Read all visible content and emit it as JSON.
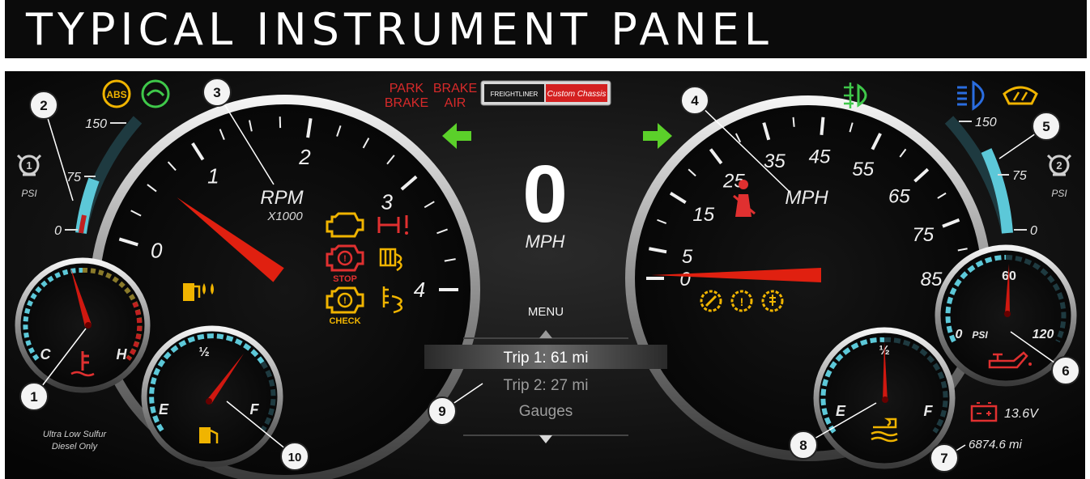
{
  "title": "TYPICAL INSTRUMENT PANEL",
  "tachometer": {
    "label": "RPM",
    "unit": "X1000",
    "ticks": [
      "0",
      "1",
      "2",
      "3",
      "4"
    ],
    "needle_value": 0.5
  },
  "speedometer": {
    "label": "MPH",
    "ticks": [
      "0",
      "5",
      "15",
      "25",
      "35",
      "45",
      "55",
      "65",
      "75",
      "85"
    ],
    "needle_value": 0
  },
  "digital_speed": {
    "value": "0",
    "unit": "MPH"
  },
  "park_brake": {
    "line1": "PARK",
    "line2": "BRAKE"
  },
  "brake_air": {
    "line1": "BRAKE",
    "line2": "AIR"
  },
  "logo": {
    "brand": "FREIGHTLINER",
    "sub": "Custom Chassis"
  },
  "air_gauge_left": {
    "unit": "PSI",
    "ticks": [
      "150",
      "75",
      "0"
    ],
    "badge": "1"
  },
  "air_gauge_right": {
    "unit": "PSI",
    "ticks": [
      "150",
      "75",
      "0"
    ],
    "badge": "2"
  },
  "temp_gauge": {
    "cold": "C",
    "hot": "H"
  },
  "fuel_gauge": {
    "empty": "E",
    "full": "F",
    "half": "½"
  },
  "def_gauge": {
    "empty": "E",
    "full": "F",
    "half": "½"
  },
  "oil_gauge": {
    "min": "0",
    "unit": "PSI",
    "mid": "60",
    "max": "120"
  },
  "warning_lights": {
    "stop": "STOP",
    "check": "CHECK",
    "abs": "ABS"
  },
  "menu": {
    "title": "MENU",
    "items": [
      "Trip 1: 61 mi",
      "Trip 2: 27 mi",
      "Gauges"
    ],
    "selected": 0
  },
  "battery": {
    "value": "13.6V"
  },
  "odometer": {
    "value": "6874.6 mi"
  },
  "fuel_note": {
    "line1": "Ultra Low Sulfur",
    "line2": "Diesel Only"
  },
  "callouts": [
    "1",
    "2",
    "3",
    "4",
    "5",
    "6",
    "7",
    "8",
    "9",
    "10"
  ],
  "colors": {
    "needle": "#e02010",
    "amber": "#f0b400",
    "red_warning": "#e03030",
    "green_arrow": "#5bd02a",
    "blue_indicator": "#2a6de0",
    "teal_scale": "#5cc8d8"
  }
}
